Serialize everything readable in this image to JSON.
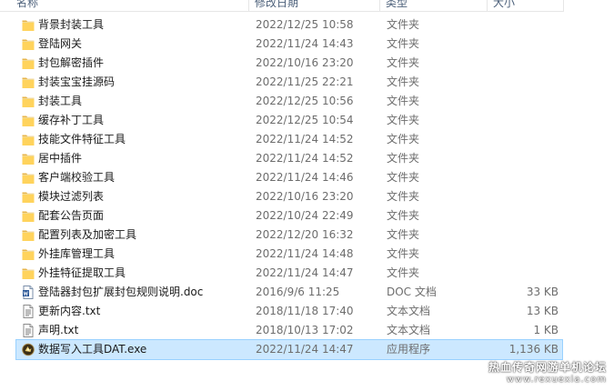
{
  "header": {
    "name": "名称",
    "date": "修改日期",
    "type": "类型",
    "size": "大小"
  },
  "files": [
    {
      "name": "背景封装工具",
      "date": "2022/12/25 10:58",
      "type": "文件夹",
      "size": "",
      "icon": "folder-icon"
    },
    {
      "name": "登陆网关",
      "date": "2022/11/24 14:43",
      "type": "文件夹",
      "size": "",
      "icon": "folder-icon"
    },
    {
      "name": "封包解密插件",
      "date": "2022/10/16 23:20",
      "type": "文件夹",
      "size": "",
      "icon": "folder-icon"
    },
    {
      "name": "封装宝宝挂源码",
      "date": "2022/11/25 22:21",
      "type": "文件夹",
      "size": "",
      "icon": "folder-icon"
    },
    {
      "name": "封装工具",
      "date": "2022/12/25 10:56",
      "type": "文件夹",
      "size": "",
      "icon": "folder-icon"
    },
    {
      "name": "缓存补丁工具",
      "date": "2022/12/25 10:54",
      "type": "文件夹",
      "size": "",
      "icon": "folder-icon"
    },
    {
      "name": "技能文件特征工具",
      "date": "2022/11/24 14:52",
      "type": "文件夹",
      "size": "",
      "icon": "folder-icon"
    },
    {
      "name": "居中插件",
      "date": "2022/11/24 14:52",
      "type": "文件夹",
      "size": "",
      "icon": "folder-icon"
    },
    {
      "name": "客户端校验工具",
      "date": "2022/11/24 14:46",
      "type": "文件夹",
      "size": "",
      "icon": "folder-icon"
    },
    {
      "name": "模块过滤列表",
      "date": "2022/10/16 23:20",
      "type": "文件夹",
      "size": "",
      "icon": "folder-icon"
    },
    {
      "name": "配套公告页面",
      "date": "2022/10/24 22:49",
      "type": "文件夹",
      "size": "",
      "icon": "folder-icon"
    },
    {
      "name": "配置列表及加密工具",
      "date": "2022/12/20 16:32",
      "type": "文件夹",
      "size": "",
      "icon": "folder-icon"
    },
    {
      "name": "外挂库管理工具",
      "date": "2022/11/24 14:48",
      "type": "文件夹",
      "size": "",
      "icon": "folder-icon"
    },
    {
      "name": "外挂特征提取工具",
      "date": "2022/11/24 14:47",
      "type": "文件夹",
      "size": "",
      "icon": "folder-icon"
    },
    {
      "name": "登陆器封包扩展封包规则说明.doc",
      "date": "2016/9/6 11:25",
      "type": "DOC 文档",
      "size": "33 KB",
      "icon": "word-doc-icon"
    },
    {
      "name": "更新内容.txt",
      "date": "2018/11/18 17:40",
      "type": "文本文档",
      "size": "13 KB",
      "icon": "text-file-icon"
    },
    {
      "name": "声明.txt",
      "date": "2018/10/13 17:02",
      "type": "文本文档",
      "size": "1 KB",
      "icon": "text-file-icon"
    },
    {
      "name": "数据写入工具DAT.exe",
      "date": "2022/11/24 14:47",
      "type": "应用程序",
      "size": "1,136 KB",
      "icon": "exe-app-icon",
      "selected": true
    }
  ],
  "watermark": {
    "title": "热血传奇网游单机论坛",
    "url": "www.rexuexia.com"
  }
}
